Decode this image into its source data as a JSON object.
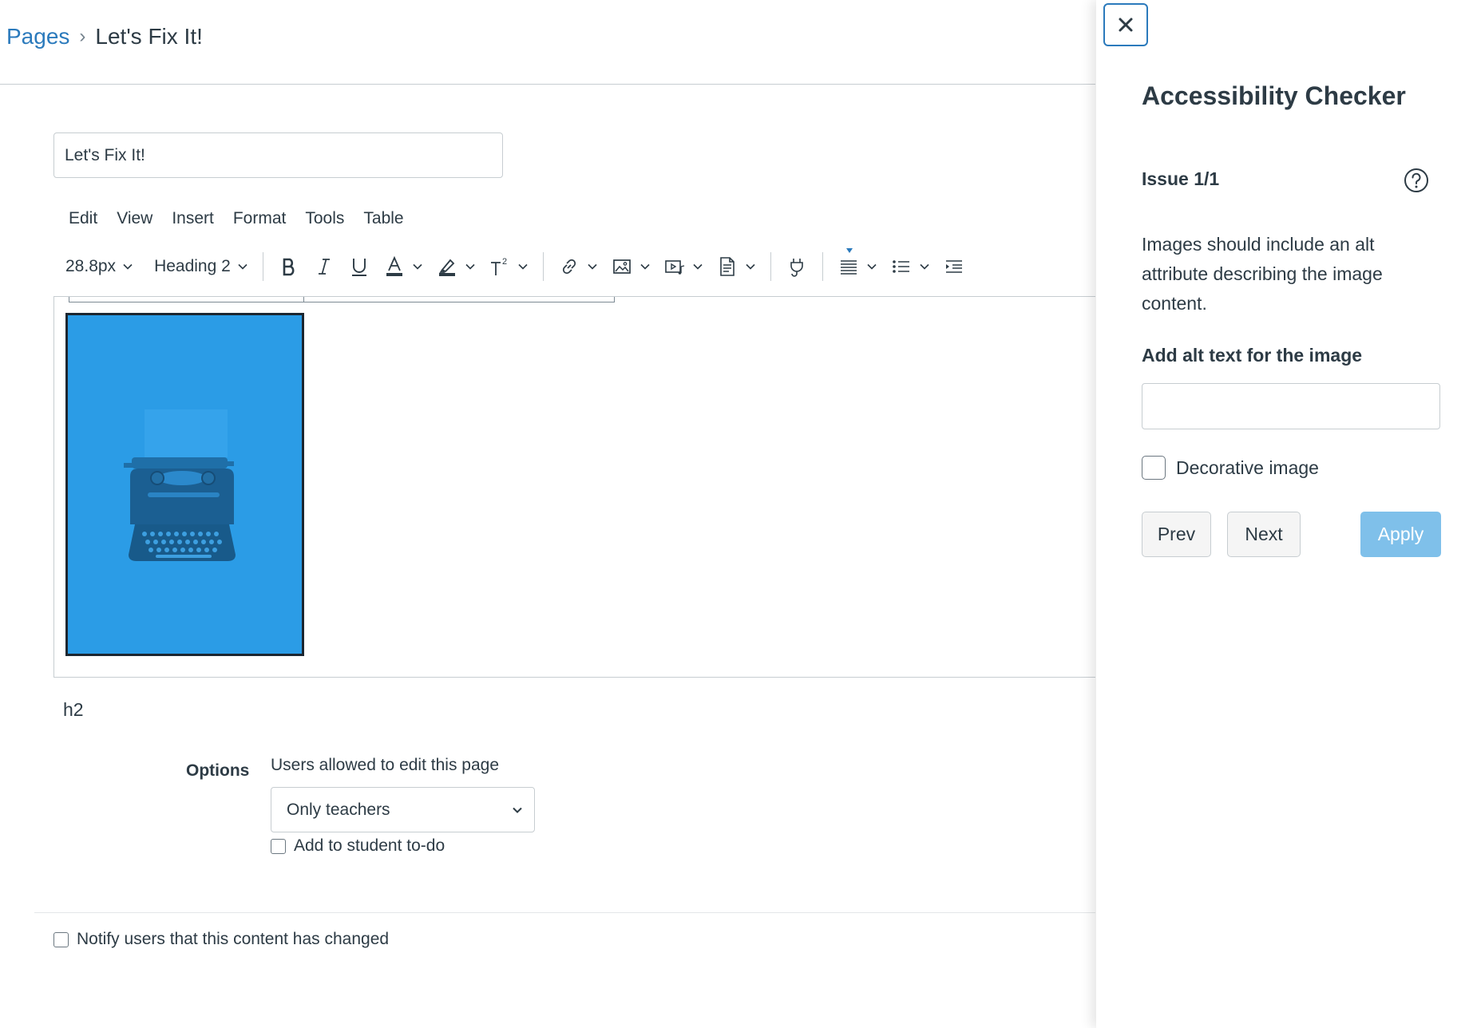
{
  "breadcrumb": {
    "root": "Pages",
    "separator": "›",
    "current": "Let's Fix It!"
  },
  "title_input": {
    "value": "Let's Fix It!"
  },
  "menubar": {
    "items": [
      "Edit",
      "View",
      "Insert",
      "Format",
      "Tools",
      "Table"
    ]
  },
  "toolbar": {
    "font_size": "28.8px",
    "block_format": "Heading 2",
    "superscript_label": "2",
    "icons": [
      "bold-icon",
      "italic-icon",
      "underline-icon",
      "text-color-icon",
      "highlight-icon",
      "superscript-icon",
      "link-icon",
      "image-icon",
      "media-icon",
      "document-icon",
      "apps-plug-icon",
      "align-icon",
      "bullet-list-icon",
      "indent-icon"
    ]
  },
  "editor": {
    "image_description": "typewriter-image",
    "image_tint": "#2b9ce6",
    "status_path": "h2"
  },
  "options": {
    "label": "Options",
    "edit_permission_label": "Users allowed to edit this page",
    "edit_permission_value": "Only teachers",
    "todo_label": "Add to student to-do",
    "notify_label": "Notify users that this content has changed"
  },
  "a11y_tray": {
    "title": "Accessibility Checker",
    "issue_counter": "Issue 1/1",
    "issue_message": "Images should include an alt attribute describing the image content.",
    "alt_text_label": "Add alt text for the image",
    "alt_text_value": "",
    "decorative_label": "Decorative image",
    "prev_label": "Prev",
    "next_label": "Next",
    "apply_label": "Apply"
  },
  "colors": {
    "link": "#2b7abc",
    "text": "#2d3b45",
    "border": "#c7cdd1",
    "apply_disabled": "#7fc0ea",
    "image_tint": "#2b9ce6"
  }
}
